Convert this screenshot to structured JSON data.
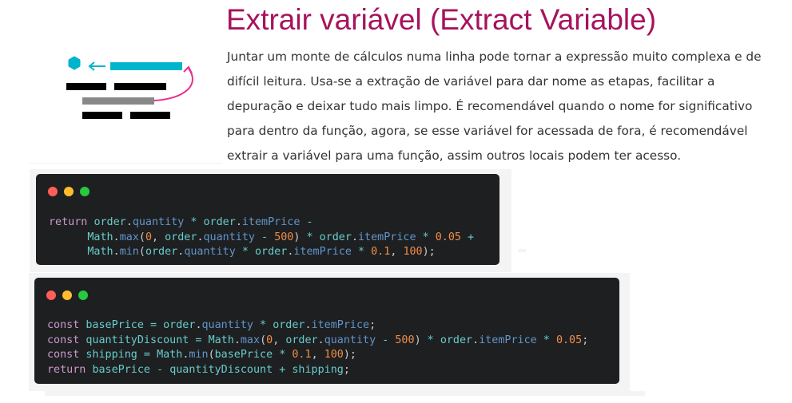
{
  "header": {
    "title": "Extrair variável (Extract Variable)",
    "description": "Juntar um monte de cálculos numa linha pode tornar a expressão muito complexa e de difícil leitura. Usa-se a extração de variável para dar nome as etapas, facilitar a depuração e deixar tudo mais limpo. É recomendável quando o nome for significativo para dentro da função, agora, se esse variável for acessada de fora, é recomendável extrair a variável para uma função, assim outros locais podem ter acesso."
  },
  "illustration": {
    "icon": "extract-variable-diagram-icon",
    "colors": {
      "accent": "#00b4cc",
      "arrow": "#e8308c",
      "bar": "#000000",
      "gray": "#888888"
    }
  },
  "code_before": {
    "lines": [
      [
        {
          "t": "return ",
          "c": "k"
        },
        {
          "t": "order",
          "c": "v"
        },
        {
          "t": ".",
          "c": "p"
        },
        {
          "t": "quantity",
          "c": "pr"
        },
        {
          "t": " * ",
          "c": "o"
        },
        {
          "t": "order",
          "c": "v"
        },
        {
          "t": ".",
          "c": "p"
        },
        {
          "t": "itemPrice",
          "c": "pr"
        },
        {
          "t": " -",
          "c": "o"
        }
      ],
      [
        {
          "t": "      ",
          "c": "p"
        },
        {
          "t": "Math",
          "c": "v"
        },
        {
          "t": ".",
          "c": "p"
        },
        {
          "t": "max",
          "c": "pr"
        },
        {
          "t": "(",
          "c": "p"
        },
        {
          "t": "0",
          "c": "n"
        },
        {
          "t": ", ",
          "c": "p"
        },
        {
          "t": "order",
          "c": "v"
        },
        {
          "t": ".",
          "c": "p"
        },
        {
          "t": "quantity",
          "c": "pr"
        },
        {
          "t": " - ",
          "c": "o"
        },
        {
          "t": "500",
          "c": "n"
        },
        {
          "t": ")",
          "c": "p"
        },
        {
          "t": " * ",
          "c": "o"
        },
        {
          "t": "order",
          "c": "v"
        },
        {
          "t": ".",
          "c": "p"
        },
        {
          "t": "itemPrice",
          "c": "pr"
        },
        {
          "t": " * ",
          "c": "o"
        },
        {
          "t": "0.05",
          "c": "n"
        },
        {
          "t": " +",
          "c": "o"
        }
      ],
      [
        {
          "t": "      ",
          "c": "p"
        },
        {
          "t": "Math",
          "c": "v"
        },
        {
          "t": ".",
          "c": "p"
        },
        {
          "t": "min",
          "c": "pr"
        },
        {
          "t": "(",
          "c": "p"
        },
        {
          "t": "order",
          "c": "v"
        },
        {
          "t": ".",
          "c": "p"
        },
        {
          "t": "quantity",
          "c": "pr"
        },
        {
          "t": " * ",
          "c": "o"
        },
        {
          "t": "order",
          "c": "v"
        },
        {
          "t": ".",
          "c": "p"
        },
        {
          "t": "itemPrice",
          "c": "pr"
        },
        {
          "t": " * ",
          "c": "o"
        },
        {
          "t": "0.1",
          "c": "n"
        },
        {
          "t": ", ",
          "c": "p"
        },
        {
          "t": "100",
          "c": "n"
        },
        {
          "t": ");",
          "c": "p"
        }
      ]
    ]
  },
  "code_after": {
    "lines": [
      [
        {
          "t": "const ",
          "c": "k"
        },
        {
          "t": "basePrice",
          "c": "v"
        },
        {
          "t": " = ",
          "c": "o"
        },
        {
          "t": "order",
          "c": "v"
        },
        {
          "t": ".",
          "c": "p"
        },
        {
          "t": "quantity",
          "c": "pr"
        },
        {
          "t": " * ",
          "c": "o"
        },
        {
          "t": "order",
          "c": "v"
        },
        {
          "t": ".",
          "c": "p"
        },
        {
          "t": "itemPrice",
          "c": "pr"
        },
        {
          "t": ";",
          "c": "p"
        }
      ],
      [
        {
          "t": "const ",
          "c": "k"
        },
        {
          "t": "quantityDiscount",
          "c": "v"
        },
        {
          "t": " = ",
          "c": "o"
        },
        {
          "t": "Math",
          "c": "v"
        },
        {
          "t": ".",
          "c": "p"
        },
        {
          "t": "max",
          "c": "pr"
        },
        {
          "t": "(",
          "c": "p"
        },
        {
          "t": "0",
          "c": "n"
        },
        {
          "t": ", ",
          "c": "p"
        },
        {
          "t": "order",
          "c": "v"
        },
        {
          "t": ".",
          "c": "p"
        },
        {
          "t": "quantity",
          "c": "pr"
        },
        {
          "t": " - ",
          "c": "o"
        },
        {
          "t": "500",
          "c": "n"
        },
        {
          "t": ")",
          "c": "p"
        },
        {
          "t": " * ",
          "c": "o"
        },
        {
          "t": "order",
          "c": "v"
        },
        {
          "t": ".",
          "c": "p"
        },
        {
          "t": "itemPrice",
          "c": "pr"
        },
        {
          "t": " * ",
          "c": "o"
        },
        {
          "t": "0.05",
          "c": "n"
        },
        {
          "t": ";",
          "c": "p"
        }
      ],
      [
        {
          "t": "const ",
          "c": "k"
        },
        {
          "t": "shipping",
          "c": "v"
        },
        {
          "t": " = ",
          "c": "o"
        },
        {
          "t": "Math",
          "c": "v"
        },
        {
          "t": ".",
          "c": "p"
        },
        {
          "t": "min",
          "c": "pr"
        },
        {
          "t": "(",
          "c": "p"
        },
        {
          "t": "basePrice",
          "c": "v"
        },
        {
          "t": " * ",
          "c": "o"
        },
        {
          "t": "0.1",
          "c": "n"
        },
        {
          "t": ", ",
          "c": "p"
        },
        {
          "t": "100",
          "c": "n"
        },
        {
          "t": ");",
          "c": "p"
        }
      ],
      [
        {
          "t": "return ",
          "c": "k"
        },
        {
          "t": "basePrice",
          "c": "v"
        },
        {
          "t": " - ",
          "c": "o"
        },
        {
          "t": "quantityDiscount",
          "c": "v"
        },
        {
          "t": " + ",
          "c": "o"
        },
        {
          "t": "shipping",
          "c": "v"
        },
        {
          "t": ";",
          "c": "p"
        }
      ]
    ]
  }
}
